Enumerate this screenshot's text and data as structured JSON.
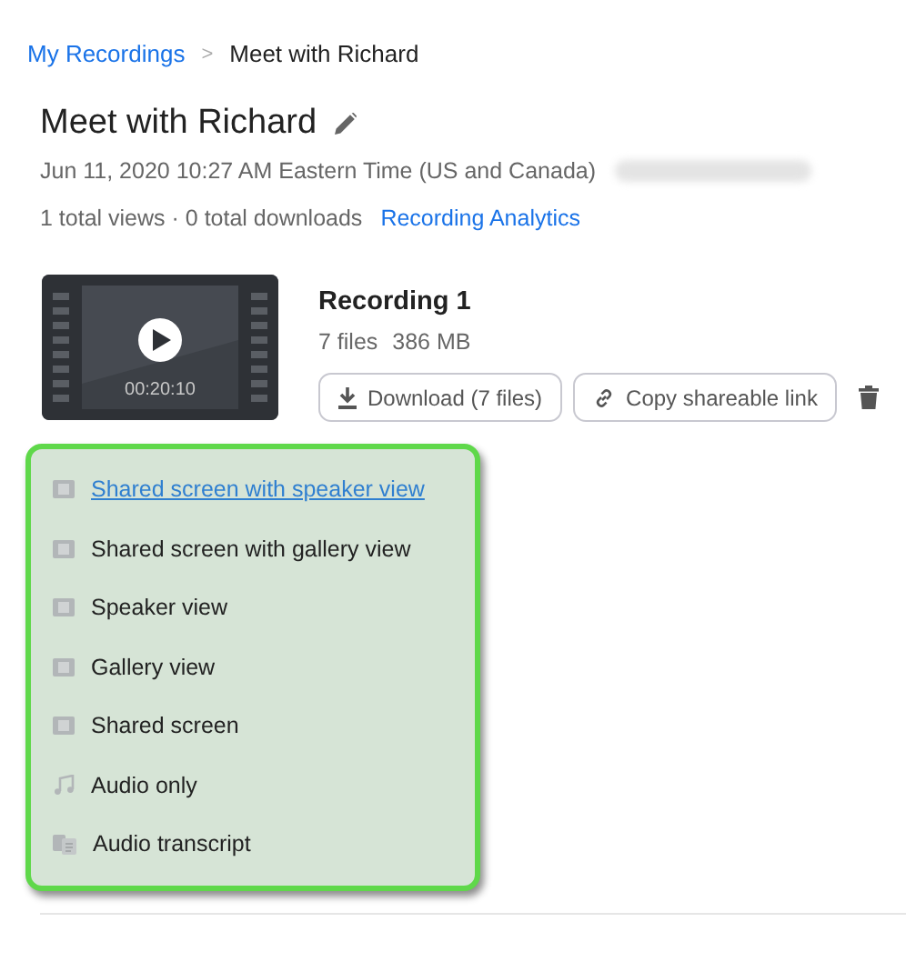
{
  "breadcrumb": {
    "parent": "My Recordings",
    "separator": ">",
    "current": "Meet with Richard"
  },
  "meeting": {
    "title": "Meet with Richard",
    "date": "Jun 11, 2020 10:27 AM Eastern Time (US and Canada)",
    "stats": "1 total views · 0 total downloads",
    "analytics_link": "Recording Analytics"
  },
  "recording": {
    "title": "Recording 1",
    "files": "7 files",
    "size": "386 MB",
    "duration": "00:20:10",
    "buttons": [
      {
        "kind": "download",
        "label": "Download (7 files)"
      },
      {
        "kind": "link",
        "label": "Copy shareable link"
      }
    ]
  },
  "files": [
    {
      "kind": "video",
      "label": "Shared screen with speaker view",
      "selected": true
    },
    {
      "kind": "video",
      "label": "Shared screen with gallery view",
      "selected": false
    },
    {
      "kind": "video",
      "label": "Speaker view",
      "selected": false
    },
    {
      "kind": "video",
      "label": "Gallery view",
      "selected": false
    },
    {
      "kind": "video",
      "label": "Shared screen",
      "selected": false
    },
    {
      "kind": "audio",
      "label": "Audio only",
      "selected": false
    },
    {
      "kind": "transcript",
      "label": "Audio transcript",
      "selected": false
    }
  ]
}
